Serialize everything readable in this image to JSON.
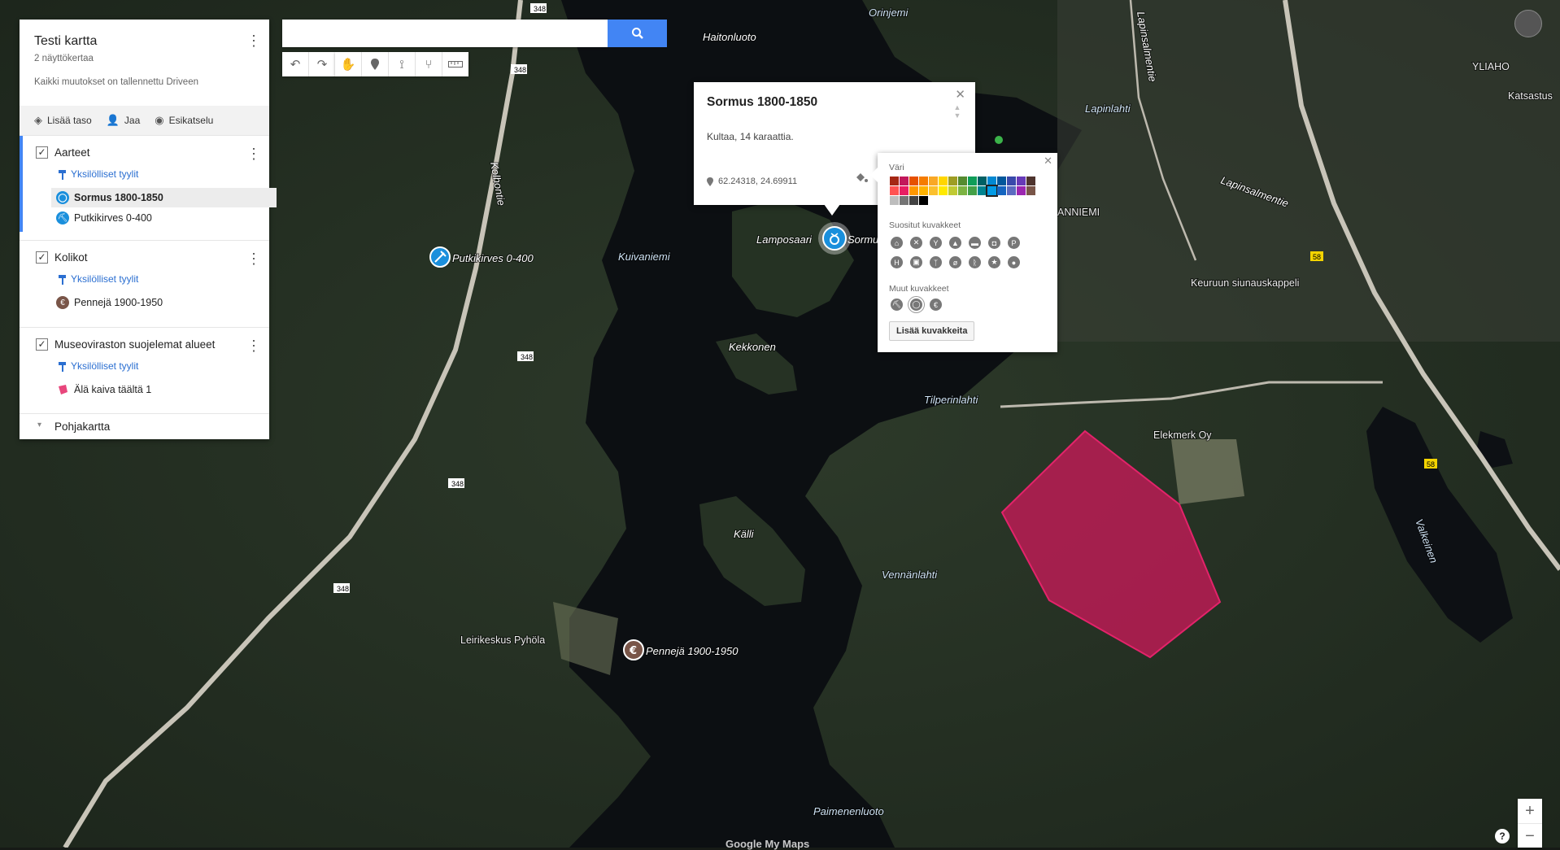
{
  "app": {
    "map_title": "Testi kartta",
    "views": "2 näyttökertaa",
    "saved_status": "Kaikki muutokset on tallennettu Driveen"
  },
  "toolbar_left": {
    "add_layer": "Lisää taso",
    "share": "Jaa",
    "preview": "Esikatselu"
  },
  "layers": [
    {
      "name": "Aarteet",
      "checked": true,
      "style_link": "Yksilölliset tyylit",
      "items": [
        {
          "label": "Sormus 1800-1850",
          "icon": "ring-icon",
          "color": "#1a8fdc",
          "selected": true
        },
        {
          "label": "Putkikirves 0-400",
          "icon": "pickaxe-icon",
          "color": "#1a8fdc",
          "selected": false
        }
      ]
    },
    {
      "name": "Kolikot",
      "checked": true,
      "style_link": "Yksilölliset tyylit",
      "items": [
        {
          "label": "Pennejä 1900-1950",
          "icon": "euro-icon",
          "color": "#795548",
          "selected": false
        }
      ]
    },
    {
      "name": "Museoviraston suojelemat alueet",
      "checked": true,
      "style_link": "Yksilölliset tyylit",
      "items": [
        {
          "label": "Älä kaiva täältä 1",
          "icon": "polygon-icon",
          "color": "#e8467c",
          "selected": false
        }
      ]
    }
  ],
  "basemap_label": "Pohjakartta",
  "search": {
    "value": "",
    "placeholder": ""
  },
  "map_tools": [
    "undo-icon",
    "redo-icon",
    "hand-icon",
    "marker-icon",
    "line-icon",
    "directions-icon",
    "ruler-icon"
  ],
  "info_window": {
    "title": "Sormus 1800-1850",
    "description": "Kultaa,  14 karaattia.",
    "coordinates": "62.24318, 24.69911"
  },
  "style_popup": {
    "color_label": "Väri",
    "suggested_label": "Suositut kuvakkeet",
    "other_label": "Muut kuvakkeet",
    "more_button": "Lisää kuvakkeita",
    "colors": [
      "#a52714",
      "#c2185b",
      "#e65100",
      "#f57c00",
      "#f9a825",
      "#ffd600",
      "#9e9d24",
      "#558b2f",
      "#0f9d58",
      "#006064",
      "#0288d1",
      "#01579b",
      "#3949ab",
      "#673ab7",
      "#4e342e",
      "#ff5252",
      "#e91e63",
      "#ff9800",
      "#ffb300",
      "#fbc02d",
      "#ffea00",
      "#c0ca33",
      "#7cb342",
      "#43a047",
      "#00838f",
      "#039be5",
      "#1565c0",
      "#5c6bc0",
      "#9c27b0",
      "#795548",
      "#bdbdbd",
      "#757575",
      "#424242",
      "#000000"
    ],
    "selected_color": "#039be5",
    "suggested_icons": [
      "home-icon",
      "cross-icon",
      "cocktail-icon",
      "shopping-icon",
      "car-icon",
      "camera-icon",
      "parking-icon",
      "hospital-icon",
      "bus-icon",
      "walking-icon",
      "bicycle-icon",
      "runner-icon",
      "star-icon",
      "pin-icon"
    ],
    "other_icons": [
      "pickaxe-icon",
      "ring-icon",
      "euro-icon"
    ]
  },
  "map_labels": {
    "places": [
      "Haitonluoto",
      "Orinjemi",
      "Lapinlahti",
      "Lamposaari",
      "Sormus",
      "Kuivaniemi",
      "Kekkonen",
      "Tilperinlahti",
      "Källi",
      "Vennänlahti",
      "Paimenenluoto",
      "Valkeinen",
      "Elekmerk Oy",
      "Keuruun siunauskappeli",
      "Leirikeskus Pyhöla",
      "YLIAHO",
      "Katsastus",
      "Kolhontie",
      "Lapinsalmentie",
      "ANNIEMI",
      "Putkikirves 0-400",
      "Pennejä 1900-1950"
    ],
    "road_numbers": [
      "348",
      "58"
    ]
  },
  "zoom": {
    "in": "+",
    "out": "−"
  },
  "help_label": "?",
  "watermark": "Google My Maps"
}
